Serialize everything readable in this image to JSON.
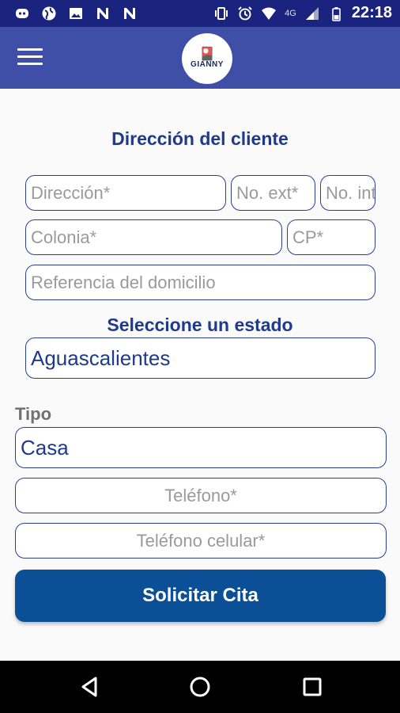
{
  "status_bar": {
    "time": "22:18",
    "network": "4G",
    "left_icons": [
      "discord-icon",
      "globe-icon",
      "image-icon",
      "n-app-icon",
      "n-app-icon"
    ],
    "right_icons": [
      "vibrate-icon",
      "alarm-icon",
      "wifi-icon",
      "signal-icon",
      "battery-icon"
    ]
  },
  "app_bar": {
    "logo_text": "GIANNY",
    "menu_icon": "hamburger-menu-icon"
  },
  "address_section": {
    "title": "Dirección del cliente",
    "direccion_placeholder": "Dirección*",
    "no_ext_placeholder": "No. ext*",
    "no_int_placeholder": "No. int",
    "colonia_placeholder": "Colonia*",
    "cp_placeholder": "CP*",
    "referencia_placeholder": "Referencia del domicilio"
  },
  "estado_section": {
    "title": "Seleccione un estado",
    "selected": "Aguascalientes"
  },
  "tipo_section": {
    "label": "Tipo",
    "selected": "Casa"
  },
  "contact": {
    "telefono_placeholder": "Teléfono*",
    "celular_placeholder": "Teléfono celular*"
  },
  "submit_label": "Solicitar Cita",
  "colors": {
    "status_bar": "#1a237e",
    "app_bar": "#3f4fa8",
    "accent_text": "#1f3a8a",
    "button": "#0b4f96"
  }
}
